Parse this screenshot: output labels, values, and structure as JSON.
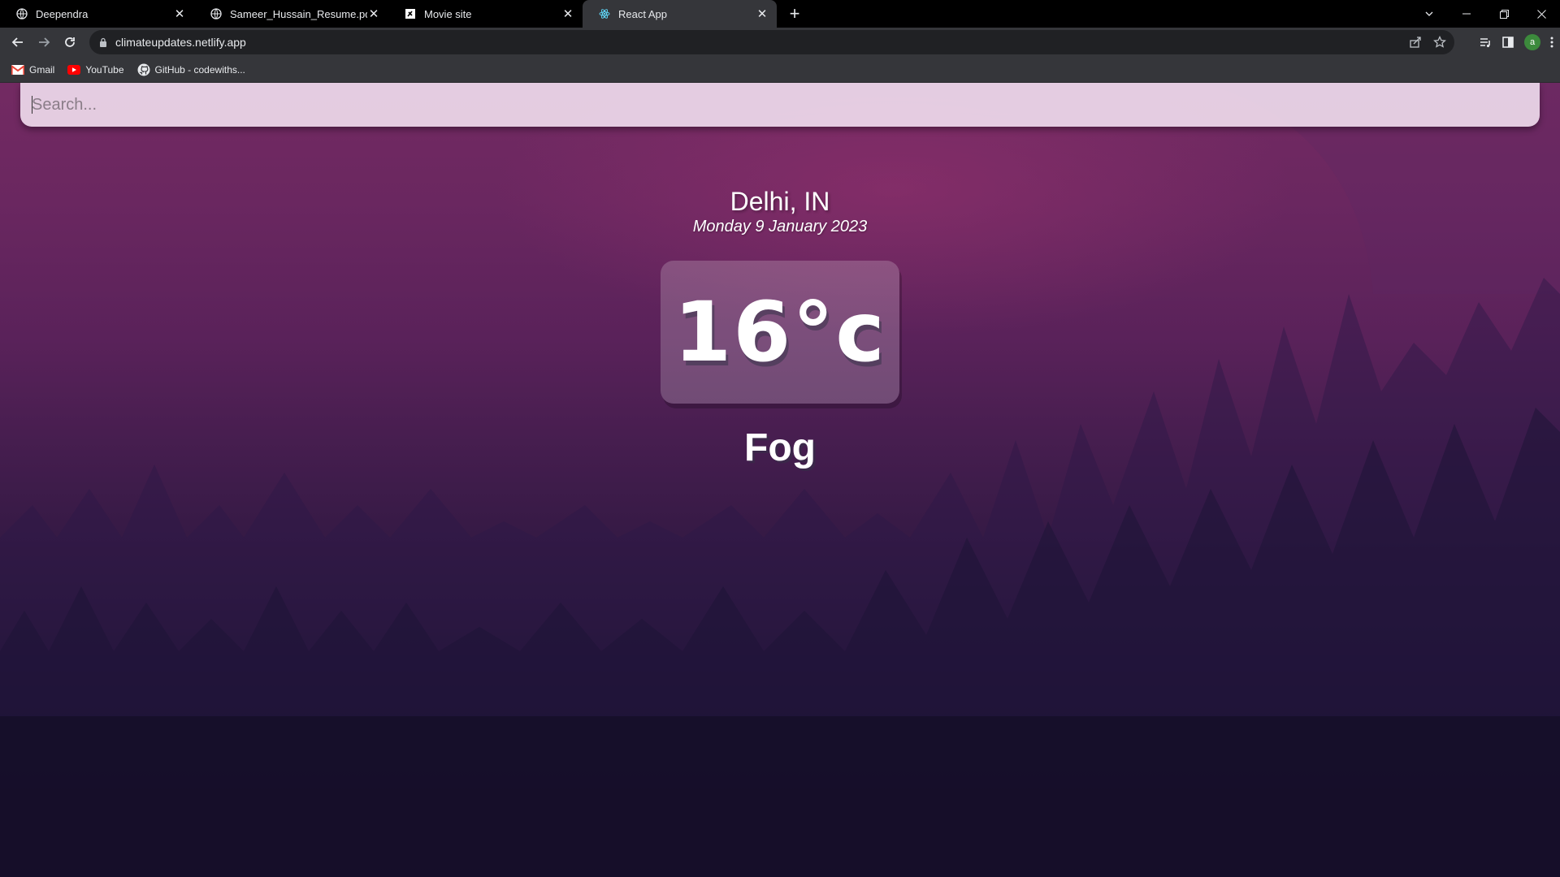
{
  "browser": {
    "tabs": [
      {
        "title": "Deependra",
        "icon": "globe-icon",
        "active": false
      },
      {
        "title": "Sameer_Hussain_Resume.pdf",
        "icon": "globe-icon",
        "active": false
      },
      {
        "title": "Movie site",
        "icon": "movie-site-icon",
        "active": false
      },
      {
        "title": "React App",
        "icon": "react-icon",
        "active": true
      }
    ],
    "url": "climateupdates.netlify.app",
    "profile_initial": "a",
    "bookmarks": [
      {
        "label": "Gmail",
        "icon": "gmail-icon"
      },
      {
        "label": "YouTube",
        "icon": "youtube-icon"
      },
      {
        "label": "GitHub - codewiths...",
        "icon": "github-icon"
      }
    ]
  },
  "app": {
    "search": {
      "placeholder": "Search...",
      "value": ""
    },
    "location": "Delhi, IN",
    "date": "Monday 9 January 2023",
    "temperature": "16°c",
    "condition": "Fog"
  },
  "colors": {
    "tab_bar": "#000000",
    "toolbar": "#35363a",
    "page_top": "#732a62",
    "page_bottom": "#130d24",
    "search_bg": "#eedaec"
  }
}
